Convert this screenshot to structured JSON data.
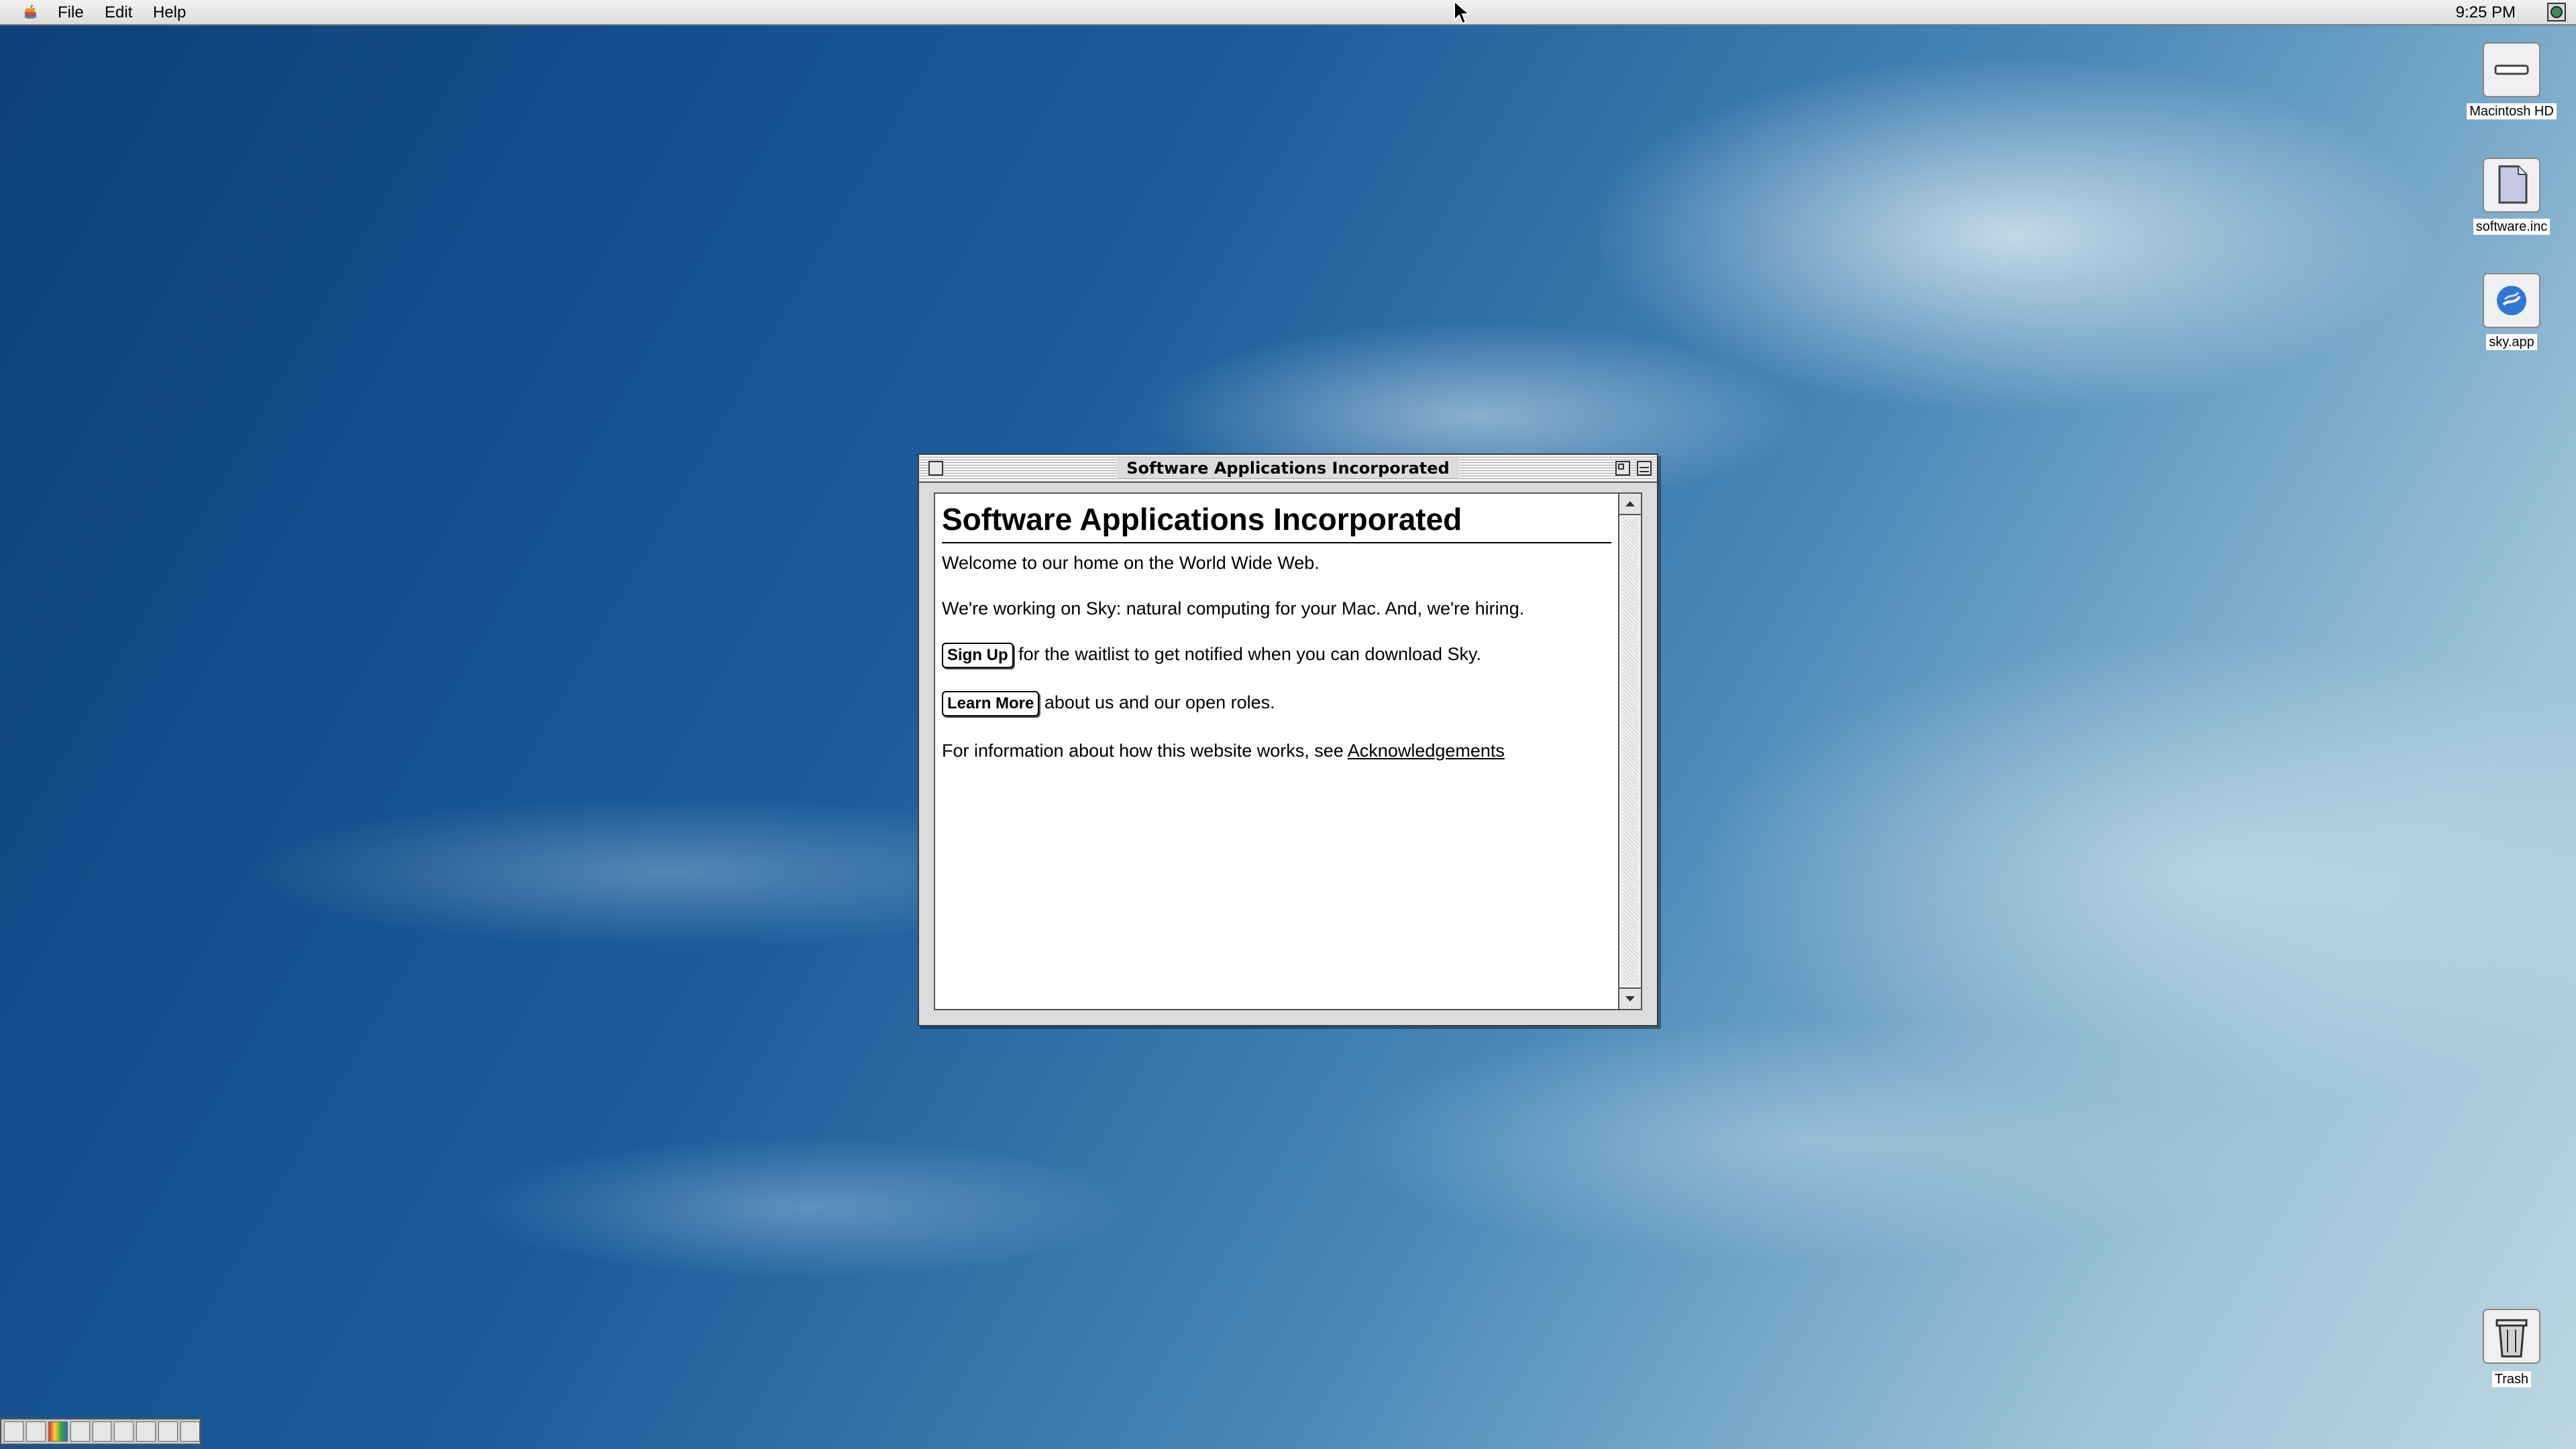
{
  "menubar": {
    "apple_icon": "apple-icon",
    "items": [
      "File",
      "Edit",
      "Help"
    ],
    "clock": "9:25 PM",
    "app_icon": "finder-icon"
  },
  "desktop_icons": [
    {
      "label": "Macintosh HD",
      "icon": "hard-drive-icon"
    },
    {
      "label": "software.inc",
      "icon": "document-icon"
    },
    {
      "label": "sky.app",
      "icon": "sky-app-icon"
    },
    {
      "label": "Trash",
      "icon": "trash-icon"
    }
  ],
  "window": {
    "title": "Software Applications Incorporated",
    "heading": "Software Applications Incorporated",
    "paragraphs": {
      "welcome": "Welcome to our home on the World Wide Web.",
      "working": "We're working on Sky: natural computing for your Mac. And, we're hiring."
    },
    "signup": {
      "button_label": "Sign Up",
      "text": " for the waitlist to get notified when you can download Sky."
    },
    "learnmore": {
      "button_label": "Learn More",
      "text": " about us and our open roles."
    },
    "info": {
      "text": "For information about how this website works, see ",
      "link_label": "Acknowledgements"
    }
  },
  "colors": {
    "desktop_sky": "#1e5a96",
    "window_chrome": "#dcdcdc",
    "content_bg": "#ffffff"
  }
}
